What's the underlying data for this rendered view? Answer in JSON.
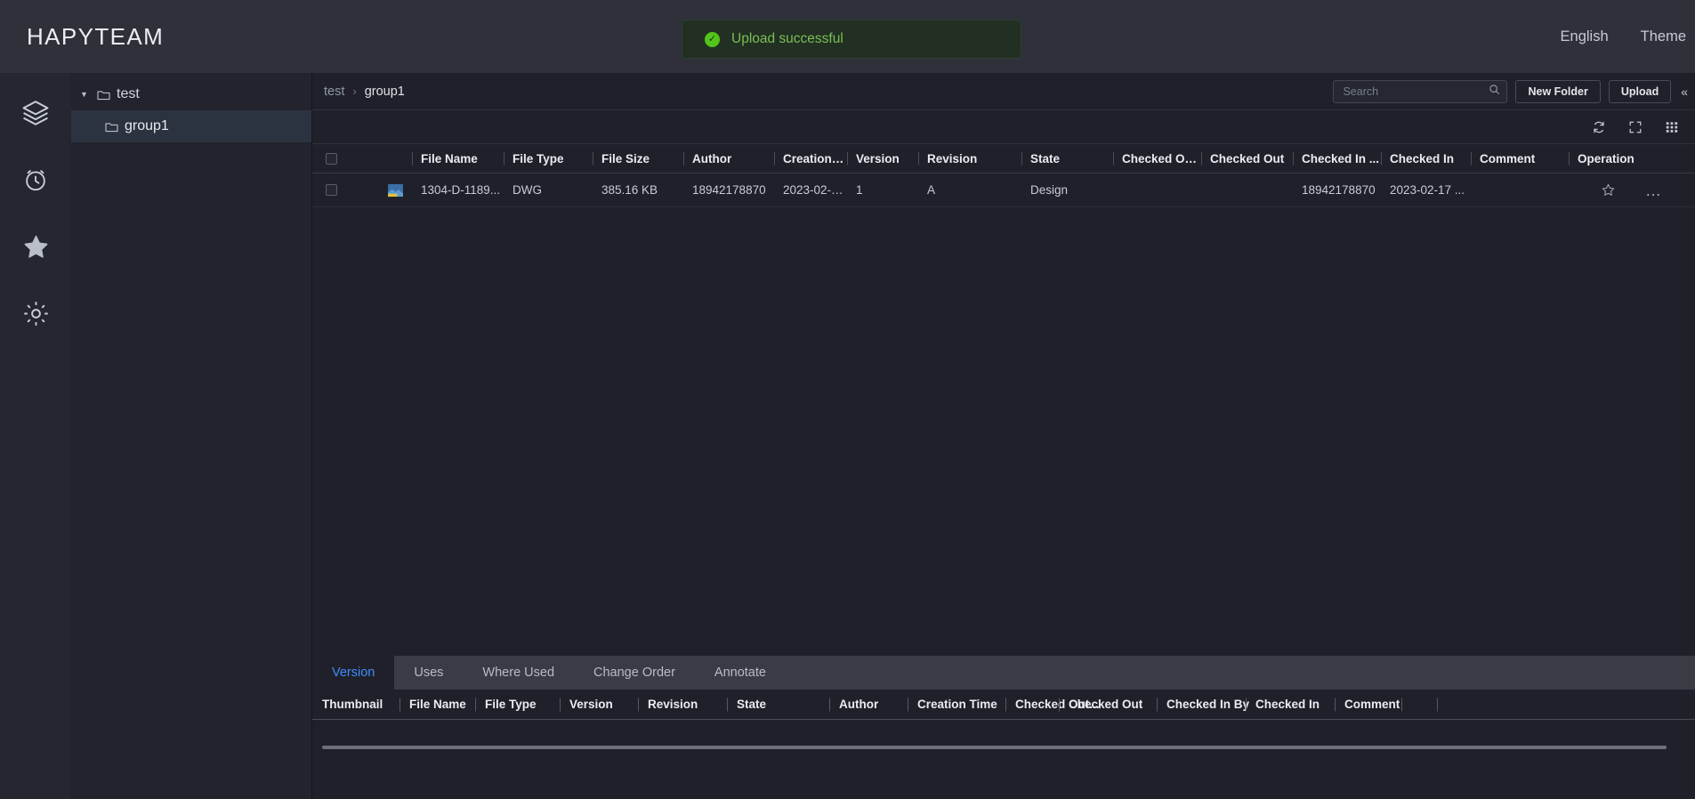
{
  "header": {
    "brand": "HAPYTEAM",
    "toast": {
      "icon": "check-circle-icon",
      "message": "Upload successful",
      "color": "#52c41a"
    },
    "links": [
      {
        "name": "language-switch",
        "label": "English"
      },
      {
        "name": "theme-switch",
        "label": "Theme"
      }
    ]
  },
  "rail": {
    "items": [
      {
        "name": "layers-icon",
        "label": "Layers"
      },
      {
        "name": "clock-icon",
        "label": "Recent"
      },
      {
        "name": "star-icon",
        "label": "Favorites"
      },
      {
        "name": "gear-icon",
        "label": "Settings"
      }
    ]
  },
  "tree": {
    "root": {
      "label": "test",
      "expanded": true
    },
    "children": [
      {
        "label": "group1",
        "selected": true
      }
    ]
  },
  "crumb": {
    "parent": "test",
    "separator": "›",
    "current": "group1"
  },
  "search": {
    "placeholder": "Search",
    "value": "",
    "icon": "search-icon"
  },
  "actions": {
    "new_folder": "New Folder",
    "upload": "Upload",
    "collapse": "«"
  },
  "toolbar_icons": [
    {
      "name": "refresh-icon"
    },
    {
      "name": "fullscreen-icon"
    },
    {
      "name": "column-settings-icon"
    }
  ],
  "file_table": {
    "columns": [
      "File Name",
      "File Type",
      "File Size",
      "Author",
      "Creation Ti...",
      "Version",
      "Revision",
      "State",
      "Checked Ou...",
      "Checked Out",
      "Checked In ...",
      "Checked In",
      "Comment",
      "Operation"
    ],
    "rows": [
      {
        "file_name": "1304-D-1189...",
        "file_type": "DWG",
        "file_size": "385.16 KB",
        "author": "18942178870",
        "creation_time": "2023-02-17 ...",
        "version": "1",
        "revision": "A",
        "state": "Design",
        "checked_out_by": "",
        "checked_out": "",
        "checked_in_by": "18942178870",
        "checked_in": "2023-02-17 ...",
        "comment": ""
      }
    ]
  },
  "detail": {
    "tabs": [
      {
        "label": "Version",
        "active": true
      },
      {
        "label": "Uses",
        "active": false
      },
      {
        "label": "Where Used",
        "active": false
      },
      {
        "label": "Change Order",
        "active": false
      },
      {
        "label": "Annotate",
        "active": false
      }
    ],
    "columns": [
      "Thumbnail",
      "File Name",
      "File Type",
      "Version",
      "Revision",
      "State",
      "Author",
      "Creation Time",
      "Checked Out...",
      "Checked Out",
      "Checked In By",
      "Checked In",
      "Comment",
      "",
      ""
    ],
    "rows": []
  }
}
